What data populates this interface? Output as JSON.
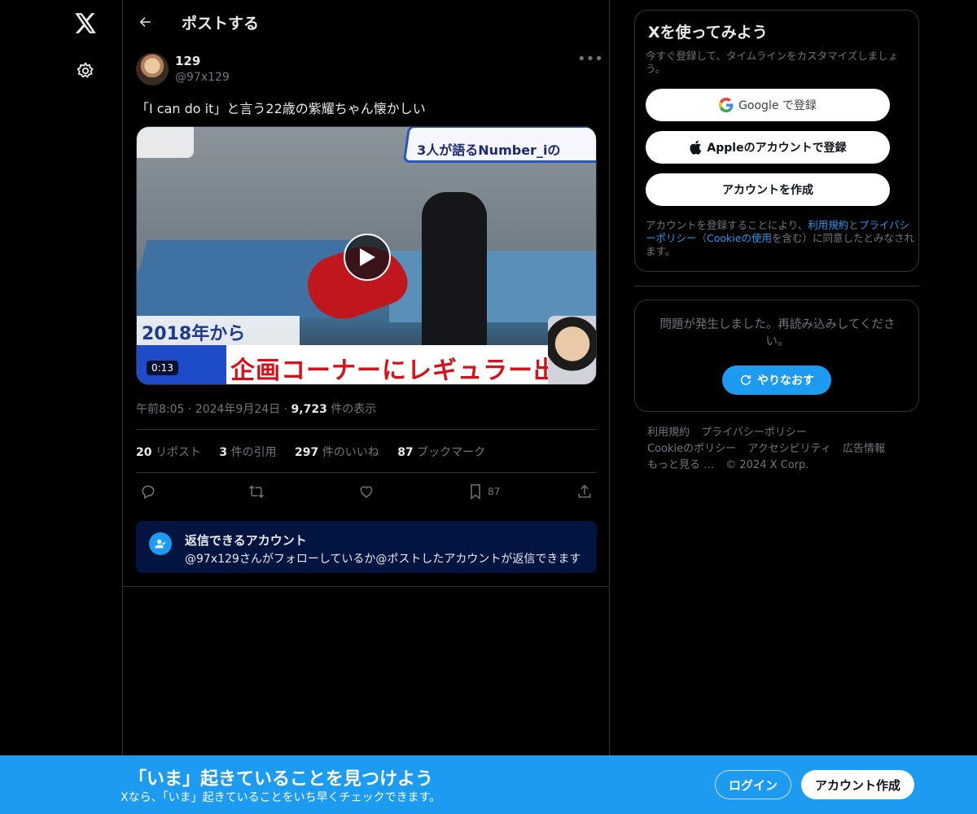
{
  "header": {
    "title": "ポストする"
  },
  "post": {
    "display_name": "𝟭𝟮𝟵",
    "handle": "@97x129",
    "text": "「I can do it」と言う22歳の紫耀ちゃん懐かしい",
    "video": {
      "duration": "0:13",
      "top_caption": "3人が語るNumber_iの",
      "bottom_small": "2018年から",
      "bottom_main": "企画コーナーにレギュラー出演"
    },
    "time": "午前8:05",
    "date": "2024年9月24日",
    "views_count": "9,723",
    "views_label": "件の表示",
    "stats": {
      "reposts_count": "20",
      "reposts_label": "リポスト",
      "quotes_count": "3",
      "quotes_label": "件の引用",
      "likes_count": "297",
      "likes_label": "件のいいね",
      "bookmarks_count": "87",
      "bookmarks_label": "ブックマーク"
    },
    "bookmark_action_count": "87"
  },
  "reply_restriction": {
    "title": "返信できるアカウント",
    "subtitle": "@97x129さんがフォローしているか@ポストしたアカウントが返信できます"
  },
  "signup": {
    "title": "Xを使ってみよう",
    "subtitle": "今すぐ登録して、タイムラインをカスタマイズしましょう。",
    "google_label": "Google で登録",
    "apple_label": "Appleのアカウントで登録",
    "create_label": "アカウントを作成",
    "legal_prefix": "アカウントを登録することにより、",
    "terms_link": "利用規約",
    "legal_and": "と",
    "privacy_link": "プライバシーポリシー",
    "legal_paren_open": "（",
    "cookie_link": "Cookieの使用",
    "legal_suffix": "を含む）に同意したとみなされます。"
  },
  "error_card": {
    "message": "問題が発生しました。再読み込みしてください。",
    "retry_label": "やりなおす"
  },
  "footer": {
    "links": [
      "利用規約",
      "プライバシーポリシー",
      "Cookieのポリシー",
      "アクセシビリティ",
      "広告情報",
      "もっと見る …",
      "© 2024 X Corp."
    ]
  },
  "bottom_bar": {
    "title": "「いま」起きていることを見つけよう",
    "subtitle": "Xなら、「いま」起きていることをいち早くチェックできます。",
    "login_label": "ログイン",
    "signup_label": "アカウント作成"
  },
  "colors": {
    "accent": "#1d9bf0",
    "background": "#000000",
    "muted": "#71767b",
    "border": "#2f3336"
  }
}
